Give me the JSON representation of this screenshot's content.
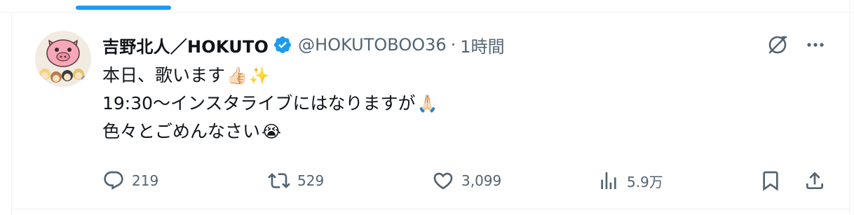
{
  "tweet": {
    "display_name": "吉野北人／HOKUTO",
    "handle": "@HOKUTOBOO36",
    "separator": "·",
    "time": "1時間",
    "lines": [
      {
        "text": "本日、歌います",
        "emojis": [
          "👍🏻",
          "✨"
        ]
      },
      {
        "text": "19:30〜インスタライブにはなりますが",
        "emojis": [
          "🙏🏻"
        ]
      },
      {
        "text": "色々とごめんなさい",
        "emojis": [
          "😭"
        ]
      }
    ]
  },
  "actions": {
    "replies": "219",
    "reposts": "529",
    "likes": "3,099",
    "views": "5.9万"
  },
  "colors": {
    "accent": "#1d9bf0",
    "muted": "#536471",
    "text": "#0f1419"
  }
}
